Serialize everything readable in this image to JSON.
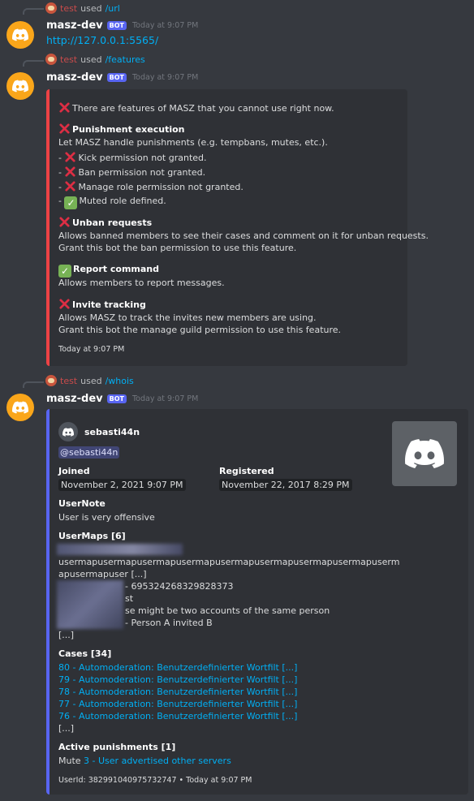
{
  "colors": {
    "accent_red": "#ed4245",
    "accent_blue": "#5865f2",
    "link": "#00aff4",
    "bot_avatar": "#faa61a"
  },
  "messages": [
    {
      "reply": {
        "user": "test",
        "verb": "used",
        "command": "/url"
      },
      "author": "masz-dev",
      "badge": "BOT",
      "timestamp": "Today at 9:07 PM",
      "content": "http://127.0.0.1:5565/"
    },
    {
      "reply": {
        "user": "test",
        "verb": "used",
        "command": "/features"
      },
      "author": "masz-dev",
      "badge": "BOT",
      "timestamp": "Today at 9:07 PM",
      "embed": {
        "intro": "There are features of MASZ that you cannot use right now.",
        "punishment_title": "Punishment execution",
        "punishment_desc": "Let MASZ handle punishments (e.g. tempbans, mutes, etc.).",
        "checks": [
          {
            "status": "x",
            "text": "Kick permission not granted."
          },
          {
            "status": "x",
            "text": "Ban permission not granted."
          },
          {
            "status": "x",
            "text": "Manage role permission not granted."
          },
          {
            "status": "ok",
            "text": "Muted role defined."
          }
        ],
        "unban_title": "Unban requests",
        "unban_desc1": "Allows banned members to see their cases and comment on it for unban requests.",
        "unban_desc2": "Grant this bot the ban permission to use this feature.",
        "report_title": "Report command",
        "report_desc": "Allows members to report messages.",
        "invite_title": "Invite tracking",
        "invite_desc1": "Allows MASZ to track the invites new members are using.",
        "invite_desc2": "Grant this bot the manage guild permission to use this feature.",
        "footer": "Today at 9:07 PM"
      }
    },
    {
      "reply": {
        "user": "test",
        "verb": "used",
        "command": "/whois"
      },
      "author": "masz-dev",
      "badge": "BOT",
      "timestamp": "Today at 9:07 PM",
      "embed": {
        "author_name": "sebasti44n",
        "mention": "@sebasti44n",
        "joined_label": "Joined",
        "joined_value": "November 2, 2021 9:07 PM",
        "registered_label": "Registered",
        "registered_value": "November 22, 2017 8:29 PM",
        "usernote_label": "UserNote",
        "usernote_value": "User is very offensive",
        "usermaps_label": "UserMaps [6]",
        "usermaps_line1": "usermapusermapusermapusermapusermapusermapusermapusermapuserm",
        "usermaps_line2": "apusermapuser [...]",
        "usermaps_line3": "- 695324268329828373",
        "usermaps_line4": "st",
        "usermaps_line5": "se might be two accounts of the same person",
        "usermaps_line6": "- Person A invited B",
        "usermaps_more": "[...]",
        "cases_label": "Cases [34]",
        "cases": [
          "80 - Automoderation: Benutzerdefinierter Wortfilt [...]",
          "79 - Automoderation: Benutzerdefinierter Wortfilt [...]",
          "78 - Automoderation: Benutzerdefinierter Wortfilt [...]",
          "77 - Automoderation: Benutzerdefinierter Wortfilt [...]",
          "76 - Automoderation: Benutzerdefinierter Wortfilt [...]"
        ],
        "cases_more": "[...]",
        "active_label": "Active punishments [1]",
        "active_prefix": "Mute",
        "active_link": "3 - User advertised other servers",
        "footer": "UserId: 382991040975732747 • Today at 9:07 PM"
      }
    }
  ]
}
